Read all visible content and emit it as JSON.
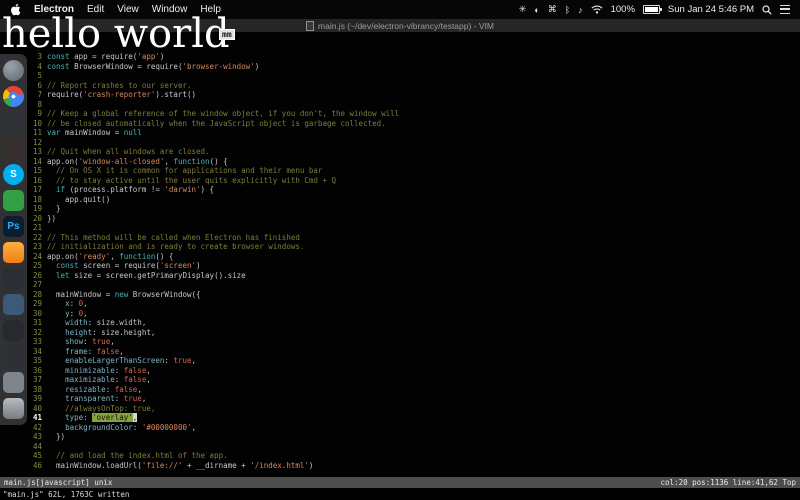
{
  "menu_bar": {
    "app_name": "Electron",
    "menus": [
      "Edit",
      "View",
      "Window",
      "Help"
    ],
    "status_icons": [
      {
        "name": "asterisk-menu-icon",
        "glyph": "✳"
      },
      {
        "name": "flux-menu-icon",
        "glyph": "◐"
      },
      {
        "name": "input-menu-icon",
        "glyph": "⌘"
      },
      {
        "name": "bluetooth-icon",
        "glyph": "ᛒ"
      },
      {
        "name": "volume-icon",
        "glyph": "♪"
      }
    ],
    "battery_percent": "100%",
    "clock": "Sun Jan 24 5:46 PM"
  },
  "title_bar": {
    "title": "main.js (~/dev/electron-vibrancy/testapp) - VIM"
  },
  "overlay": {
    "text": "hello world",
    "badge": "mm"
  },
  "dock": {
    "items": [
      {
        "name": "dock-launchpad",
        "bg": "radial-gradient(circle at 35% 30%, #9aa2ab, #5f666e)",
        "round": true
      },
      {
        "name": "dock-chrome",
        "bg": "radial-gradient(circle, #ffffff 0 12%, #4285f4 13% 32%, rgba(0,0,0,0) 33%), conic-gradient(from -45deg, #ea4335 0deg 120deg, #4285f4 120deg 240deg, #34a853 240deg 300deg, #fbbc05 300deg 360deg)",
        "round": true
      },
      {
        "name": "dock-app-dark-1",
        "bg": "#2f3237"
      },
      {
        "name": "dock-app-dark-2",
        "bg": "#38302e"
      },
      {
        "name": "dock-skype",
        "bg": "#00aff0",
        "label": "S",
        "round": true
      },
      {
        "name": "dock-app-green",
        "bg": "#34a044"
      },
      {
        "name": "dock-photoshop",
        "bg": "#0a1e2e",
        "label": "Ps",
        "fg": "#31a8ff"
      },
      {
        "name": "dock-app-orange",
        "bg": "linear-gradient(180deg,#fcb03c,#ef7f1b)"
      },
      {
        "name": "dock-app-dark-3",
        "bg": "#2a2d33"
      },
      {
        "name": "dock-app-blue",
        "bg": "#3c5a78"
      },
      {
        "name": "dock-app-dark-4",
        "bg": "#26292e"
      },
      {
        "name": "dock-app-dark-5",
        "bg": "#2d3035"
      },
      {
        "name": "dock-app-grey",
        "bg": "#7e848b"
      },
      {
        "name": "dock-trash",
        "bg": "linear-gradient(180deg,rgba(222,226,231,0.78),rgba(140,145,150,0.78))"
      }
    ]
  },
  "editor": {
    "cursor_line": 41,
    "lines": [
      {
        "n": 3,
        "t": [
          [
            "k",
            "const"
          ],
          [
            "t",
            " app = require("
          ],
          [
            "s",
            "'app'"
          ],
          [
            "t",
            ")"
          ]
        ]
      },
      {
        "n": 4,
        "t": [
          [
            "k",
            "const"
          ],
          [
            "t",
            " BrowserWindow = require("
          ],
          [
            "s",
            "'browser-window'"
          ],
          [
            "t",
            ")"
          ]
        ]
      },
      {
        "n": 5,
        "t": []
      },
      {
        "n": 6,
        "t": [
          [
            "c",
            "// Report crashes to our server."
          ]
        ]
      },
      {
        "n": 7,
        "t": [
          [
            "t",
            "require("
          ],
          [
            "s",
            "'crash-reporter'"
          ],
          [
            "t",
            ").start()"
          ]
        ]
      },
      {
        "n": 8,
        "t": []
      },
      {
        "n": 9,
        "t": [
          [
            "c",
            "// Keep a global reference of the window object, if you don't, the window will"
          ]
        ]
      },
      {
        "n": 10,
        "t": [
          [
            "c",
            "// be closed automatically when the JavaScript object is garbage collected."
          ]
        ]
      },
      {
        "n": 11,
        "t": [
          [
            "k",
            "var"
          ],
          [
            "t",
            " mainWindow = "
          ],
          [
            "k",
            "null"
          ]
        ]
      },
      {
        "n": 12,
        "t": []
      },
      {
        "n": 13,
        "t": [
          [
            "c",
            "// Quit when all windows are closed."
          ]
        ]
      },
      {
        "n": 14,
        "t": [
          [
            "t",
            "app.on("
          ],
          [
            "s",
            "'window-all-closed'"
          ],
          [
            "t",
            ", "
          ],
          [
            "k",
            "function"
          ],
          [
            "t",
            "() {"
          ]
        ]
      },
      {
        "n": 15,
        "t": [
          [
            "c",
            "  // On OS X it is common for applications and their menu bar"
          ]
        ]
      },
      {
        "n": 16,
        "t": [
          [
            "c",
            "  // to stay active until the user quits explicitly with Cmd + Q"
          ]
        ]
      },
      {
        "n": 17,
        "t": [
          [
            "t",
            "  "
          ],
          [
            "k",
            "if"
          ],
          [
            "t",
            " (process.platform != "
          ],
          [
            "s",
            "'darwin'"
          ],
          [
            "t",
            ") {"
          ]
        ]
      },
      {
        "n": 18,
        "t": [
          [
            "t",
            "    app.quit()"
          ]
        ]
      },
      {
        "n": 19,
        "t": [
          [
            "t",
            "  }"
          ]
        ]
      },
      {
        "n": 20,
        "t": [
          [
            "t",
            "})"
          ]
        ]
      },
      {
        "n": 21,
        "t": []
      },
      {
        "n": 22,
        "t": [
          [
            "c",
            "// This method will be called when Electron has finished"
          ]
        ]
      },
      {
        "n": 23,
        "t": [
          [
            "c",
            "// initialization and is ready to create browser windows."
          ]
        ]
      },
      {
        "n": 24,
        "t": [
          [
            "t",
            "app.on("
          ],
          [
            "s",
            "'ready'"
          ],
          [
            "t",
            ", "
          ],
          [
            "k",
            "function"
          ],
          [
            "t",
            "() {"
          ]
        ]
      },
      {
        "n": 25,
        "t": [
          [
            "t",
            "  "
          ],
          [
            "k",
            "const"
          ],
          [
            "t",
            " screen = require("
          ],
          [
            "s",
            "'screen'"
          ],
          [
            "t",
            ")"
          ]
        ]
      },
      {
        "n": 26,
        "t": [
          [
            "t",
            "  "
          ],
          [
            "k",
            "let"
          ],
          [
            "t",
            " size = screen.getPrimaryDisplay().size"
          ]
        ]
      },
      {
        "n": 27,
        "t": []
      },
      {
        "n": 28,
        "t": [
          [
            "t",
            "  mainWindow = "
          ],
          [
            "k",
            "new"
          ],
          [
            "t",
            " BrowserWindow({"
          ]
        ]
      },
      {
        "n": 29,
        "t": [
          [
            "t",
            "    "
          ],
          [
            "p",
            "x"
          ],
          [
            "t",
            ": "
          ],
          [
            "b",
            "0"
          ],
          [
            "t",
            ","
          ]
        ]
      },
      {
        "n": 30,
        "t": [
          [
            "t",
            "    "
          ],
          [
            "p",
            "y"
          ],
          [
            "t",
            ": "
          ],
          [
            "b",
            "0"
          ],
          [
            "t",
            ","
          ]
        ]
      },
      {
        "n": 31,
        "t": [
          [
            "t",
            "    "
          ],
          [
            "p",
            "width"
          ],
          [
            "t",
            ": size.width,"
          ]
        ]
      },
      {
        "n": 32,
        "t": [
          [
            "t",
            "    "
          ],
          [
            "p",
            "height"
          ],
          [
            "t",
            ": size.height,"
          ]
        ]
      },
      {
        "n": 33,
        "t": [
          [
            "t",
            "    "
          ],
          [
            "p",
            "show"
          ],
          [
            "t",
            ": "
          ],
          [
            "b",
            "true"
          ],
          [
            "t",
            ","
          ]
        ]
      },
      {
        "n": 34,
        "t": [
          [
            "t",
            "    "
          ],
          [
            "p",
            "frame"
          ],
          [
            "t",
            ": "
          ],
          [
            "b",
            "false"
          ],
          [
            "t",
            ","
          ]
        ]
      },
      {
        "n": 35,
        "t": [
          [
            "t",
            "    "
          ],
          [
            "p",
            "enableLargerThanScreen"
          ],
          [
            "t",
            ": "
          ],
          [
            "b",
            "true"
          ],
          [
            "t",
            ","
          ]
        ]
      },
      {
        "n": 36,
        "t": [
          [
            "t",
            "    "
          ],
          [
            "p",
            "minimizable"
          ],
          [
            "t",
            ": "
          ],
          [
            "b",
            "false"
          ],
          [
            "t",
            ","
          ]
        ]
      },
      {
        "n": 37,
        "t": [
          [
            "t",
            "    "
          ],
          [
            "p",
            "maximizable"
          ],
          [
            "t",
            ": "
          ],
          [
            "b",
            "false"
          ],
          [
            "t",
            ","
          ]
        ]
      },
      {
        "n": 38,
        "t": [
          [
            "t",
            "    "
          ],
          [
            "p",
            "resizable"
          ],
          [
            "t",
            ": "
          ],
          [
            "b",
            "false"
          ],
          [
            "t",
            ","
          ]
        ]
      },
      {
        "n": 39,
        "t": [
          [
            "t",
            "    "
          ],
          [
            "p",
            "transparent"
          ],
          [
            "t",
            ": "
          ],
          [
            "b",
            "true"
          ],
          [
            "t",
            ","
          ]
        ]
      },
      {
        "n": 40,
        "t": [
          [
            "c",
            "    //alwaysOnTop: true,"
          ]
        ]
      },
      {
        "n": 41,
        "t": [
          [
            "t",
            "    "
          ],
          [
            "p",
            "type"
          ],
          [
            "t",
            ": "
          ],
          [
            "h",
            "'overlay'"
          ],
          [
            "x",
            ","
          ]
        ]
      },
      {
        "n": 42,
        "t": [
          [
            "t",
            "    "
          ],
          [
            "p",
            "backgroundColor"
          ],
          [
            "t",
            ": "
          ],
          [
            "s",
            "'#00000000'"
          ],
          [
            "t",
            ","
          ]
        ]
      },
      {
        "n": 43,
        "t": [
          [
            "t",
            "  })"
          ]
        ]
      },
      {
        "n": 44,
        "t": []
      },
      {
        "n": 45,
        "t": [
          [
            "c",
            "  // and load the index.html of the app."
          ]
        ]
      },
      {
        "n": 46,
        "t": [
          [
            "t",
            "  mainWindow.loadUrl("
          ],
          [
            "s",
            "'file://'"
          ],
          [
            "t",
            " + __dirname + "
          ],
          [
            "s",
            "'/index.html'"
          ],
          [
            "t",
            ")"
          ]
        ]
      }
    ]
  },
  "status_line": {
    "left": "main.js[javascript] unix",
    "right": "col:20 pos:1136 line:41,62 Top"
  },
  "command_line": {
    "text": "\"main.js\" 62L, 1763C written"
  },
  "colors": {
    "syntax_keyword": "#48b4b4",
    "syntax_string": "#d7875f",
    "syntax_comment": "#7d7d3c",
    "syntax_constant": "#cf6a50",
    "line_number": "#8b8b3f",
    "search_highlight": "#86a23c",
    "statusline_bg": "#4d4d4d"
  }
}
